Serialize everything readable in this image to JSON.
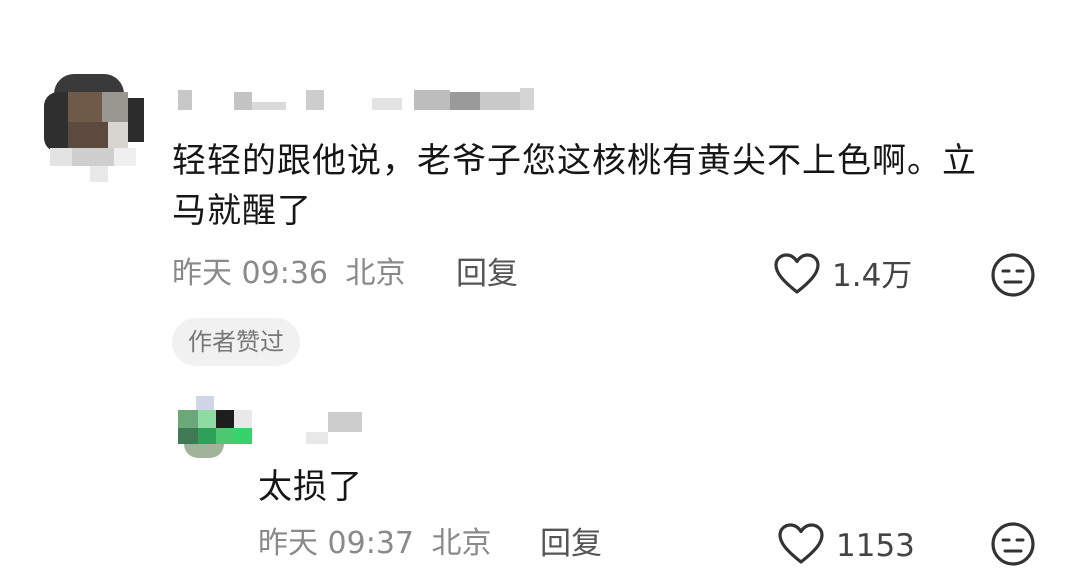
{
  "comments": [
    {
      "text_line1": "轻轻的跟他说，老爷子您这核桃有黄尖不上色啊。立",
      "text_line2": "马就醒了",
      "time": "昨天 09:36",
      "location": "北京",
      "reply_label": "回复",
      "likes": "1.4万",
      "author_badge": "作者赞过"
    },
    {
      "text": "太损了",
      "time": "昨天 09:37",
      "location": "北京",
      "reply_label": "回复",
      "likes": "1153"
    }
  ],
  "icons": {
    "like": "heart-outline-icon",
    "dislike": "neutral-face-icon"
  },
  "colors": {
    "text": "#161616",
    "meta": "#8a8a8a",
    "badge_bg": "#f1f1f1"
  }
}
